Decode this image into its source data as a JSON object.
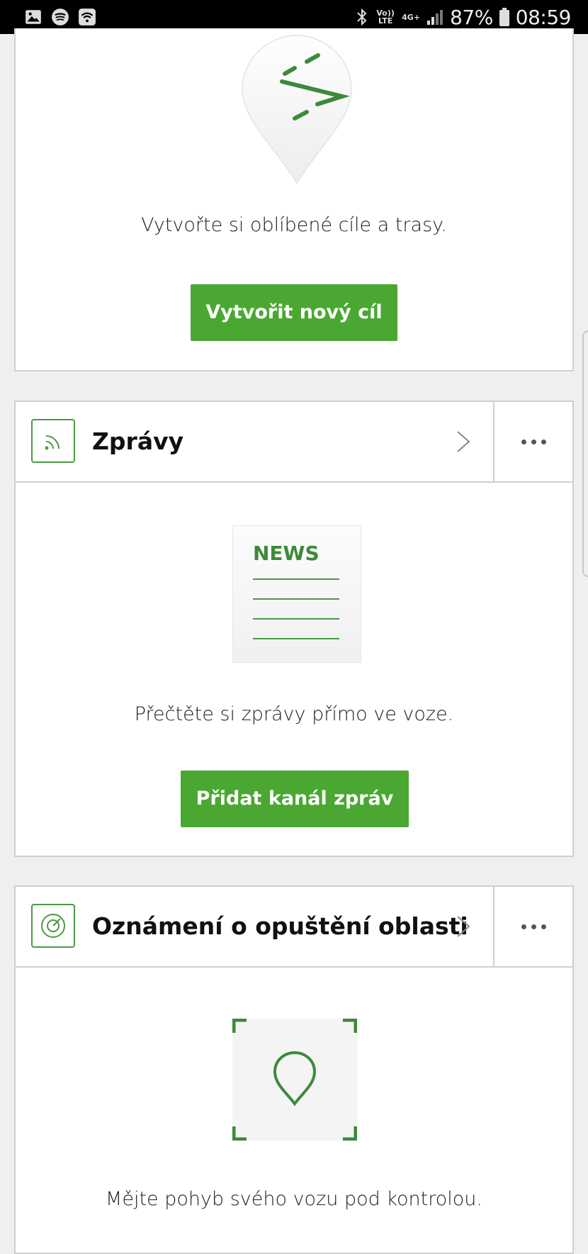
{
  "status_bar": {
    "network": "Vo)) LTE",
    "network_gen": "4G+",
    "battery": "87%",
    "time": "08:59",
    "icons": [
      "image-icon",
      "spotify-icon",
      "wifi-icon",
      "bluetooth-icon",
      "signal-icon",
      "battery-icon"
    ]
  },
  "favorites_card": {
    "description": "Vytvořte si oblíbené cíle a trasy.",
    "button_label": "Vytvořit nový cíl"
  },
  "news_card": {
    "title": "Zprávy",
    "illustration_word": "NEWS",
    "description": "Přečtěte si zprávy přímo ve voze.",
    "button_label": "Přidat kanál zpráv"
  },
  "geofence_card": {
    "title": "Oznámení o opuštění oblasti",
    "description": "Mějte pohyb svého vozu pod kontrolou."
  },
  "colors": {
    "accent_green": "#4aa832",
    "icon_green": "#4a9a45"
  }
}
